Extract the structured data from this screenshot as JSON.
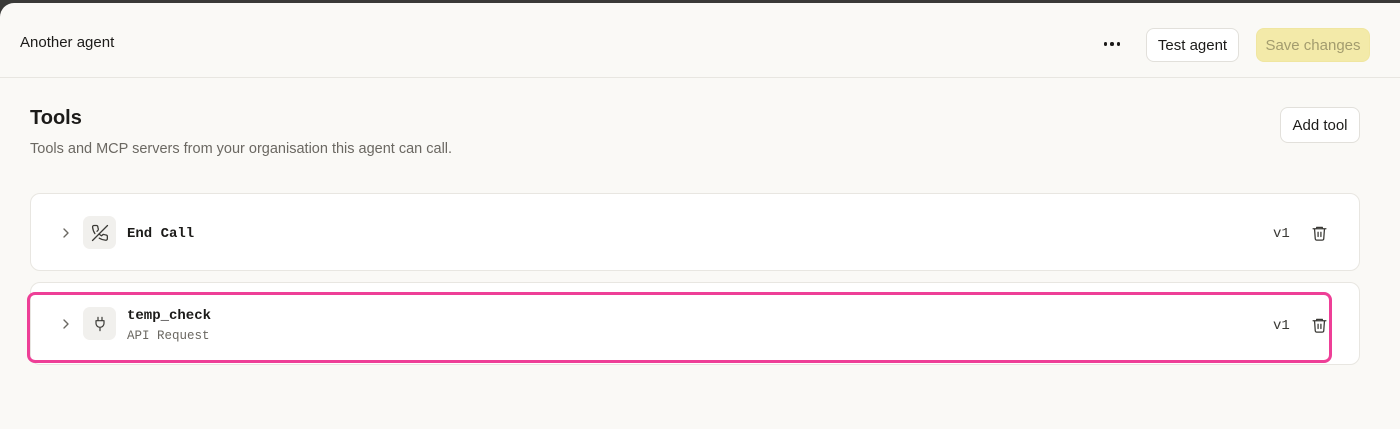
{
  "header": {
    "agent_name": "Another agent",
    "more_icon": "more-horizontal-icon",
    "test_label": "Test agent",
    "save_label": "Save changes"
  },
  "tools_section": {
    "title": "Tools",
    "subtitle": "Tools and MCP servers from your organisation this agent can call.",
    "add_label": "Add tool"
  },
  "tools": [
    {
      "name": "End Call",
      "type": "",
      "version": "v1",
      "icon": "phone-off-icon"
    },
    {
      "name": "temp_check",
      "type": "API Request",
      "version": "v1",
      "icon": "plug-icon"
    }
  ],
  "colors": {
    "accent_disabled": "#f3eaa9",
    "highlight": "#ee3f97",
    "background": "#faf9f6"
  }
}
